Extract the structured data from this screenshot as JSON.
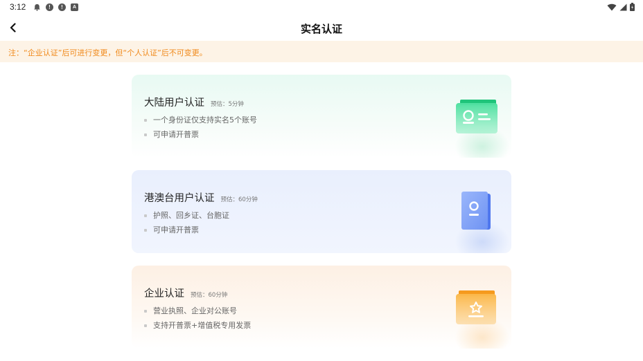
{
  "status_bar": {
    "time": "3:12",
    "left_icons": [
      "notification-icon",
      "alert-icon",
      "alert-icon",
      "app-icon"
    ],
    "right_icons": [
      "wifi-icon",
      "signal-icon",
      "battery-icon"
    ]
  },
  "header": {
    "title": "实名认证",
    "back_icon": "back-arrow-icon"
  },
  "notice": {
    "text": "注：“企业认证”后可进行变更，但“个人认证”后不可变更。",
    "color": "#f08a1c",
    "background": "#fdf3e6"
  },
  "cards": [
    {
      "title": "大陆用户认证",
      "estimate": "预估：5分钟",
      "items": [
        "一个身份证仅支持实名5个账号",
        "可申请开普票"
      ],
      "icon": "id-card-icon",
      "accent": "#2fd187"
    },
    {
      "title": "港澳台用户认证",
      "estimate": "预估：60分钟",
      "items": [
        "护照、回乡证、台胞证",
        "可申请开普票"
      ],
      "icon": "passport-icon",
      "accent": "#5b86f2"
    },
    {
      "title": "企业认证",
      "estimate": "预估：60分钟",
      "items": [
        "营业执照、企业对公账号",
        "支持开普票+增值税专用发票"
      ],
      "icon": "business-license-icon",
      "accent": "#f6a93b"
    }
  ]
}
